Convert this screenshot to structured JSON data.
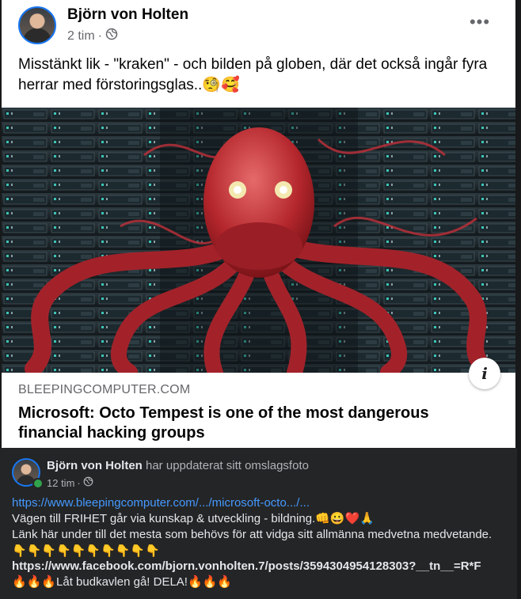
{
  "post": {
    "author": "Björn von Holten",
    "time": "2 tim",
    "text": "Misstänkt lik - \"kraken\" - och bilden på globen, där det också ingår fyra herrar med förstoringsglas..🧐🥰",
    "more_label": "•••",
    "link": {
      "domain": "BLEEPINGCOMPUTER.COM",
      "title": "Microsoft: Octo Tempest is one of the most dangerous financial hacking groups",
      "info_label": "i"
    }
  },
  "shared": {
    "author": "Björn von Holten",
    "action": "har uppdaterat sitt omslagsfoto",
    "time": "12 tim",
    "url": "https://www.bleepingcomputer.com/.../microsoft-octo.../...",
    "line1": "Vägen till FRIHET går via kunskap & utveckling - bildning.👊😀❤️🙏",
    "line2": "Länk här under till det mesta som behövs för att vidga sitt allmänna medvetna medvetande.",
    "pointers": "👇👇👇👇👇👇👇👇👇👇",
    "fb_link": "https://www.facebook.com/bjorn.vonholten.7/posts/3594304954128303?__tn__=R*F",
    "closing": "🔥🔥🔥Låt budkavlen gå! DELA!🔥🔥🔥"
  },
  "colors": {
    "accent": "#1877f2",
    "link": "#4599ff",
    "dark_bg": "#242526",
    "online": "#31a24c"
  },
  "icons": [
    "globe-icon",
    "more-icon",
    "info-icon"
  ]
}
